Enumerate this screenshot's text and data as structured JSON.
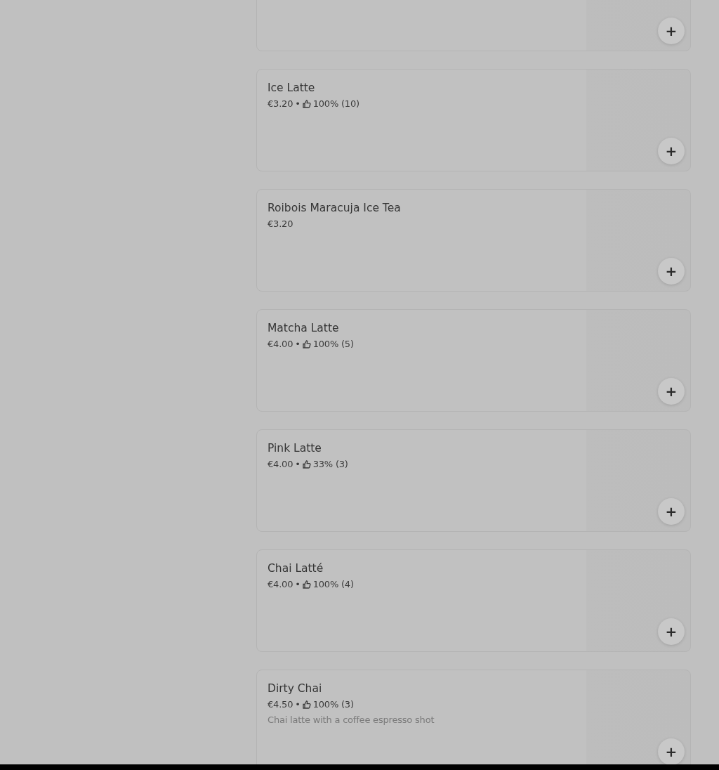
{
  "menu_items": [
    {
      "kind": "cut_off",
      "add_button": "+"
    },
    {
      "kind": "full",
      "name": "Ice Latte",
      "price": "€3.20",
      "separator": "•",
      "rating": "100% (10)",
      "add_button": "+"
    },
    {
      "kind": "full",
      "name": "Roibois Maracuja Ice Tea",
      "price": "€3.20",
      "add_button": "+"
    },
    {
      "kind": "full",
      "name": "Matcha Latte",
      "price": "€4.00",
      "separator": "•",
      "rating": "100% (5)",
      "add_button": "+"
    },
    {
      "kind": "full",
      "name": "Pink Latte",
      "price": "€4.00",
      "separator": "•",
      "rating": "33% (3)",
      "add_button": "+"
    },
    {
      "kind": "full",
      "name": "Chai Latté",
      "price": "€4.00",
      "separator": "•",
      "rating": "100% (4)",
      "add_button": "+"
    },
    {
      "kind": "full",
      "name": "Dirty Chai",
      "price": "€4.50",
      "separator": "•",
      "rating": "100% (3)",
      "description": "Chai latte with a coffee espresso shot",
      "add_button": "+"
    }
  ]
}
